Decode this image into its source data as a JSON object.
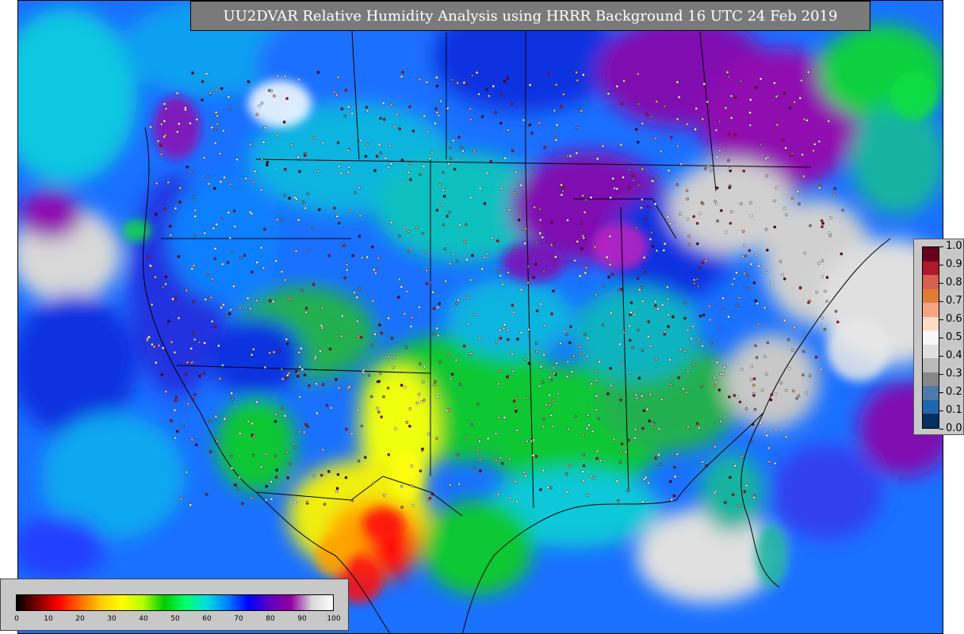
{
  "title": "UU2DVAR Relative Humidity Analysis using HRRR Background 16 UTC 24 Feb 2019",
  "rh_colorbar": {
    "ticks": [
      "0",
      "10",
      "20",
      "30",
      "40",
      "50",
      "60",
      "70",
      "80",
      "90",
      "100"
    ],
    "range": [
      0,
      100
    ],
    "colors": [
      "#000000",
      "#7f0000",
      "#ff0000",
      "#ff6a00",
      "#ffcc00",
      "#ffff00",
      "#b4ff00",
      "#00cc00",
      "#00ff66",
      "#00e0e0",
      "#0080ff",
      "#0000ff",
      "#6000c0",
      "#9000a0",
      "#d8d8d8",
      "#ffffff"
    ]
  },
  "obs_colorbar": {
    "ticks": [
      "1.0",
      "0.9",
      "0.8",
      "0.7",
      "0.6",
      "0.5",
      "0.4",
      "0.3",
      "0.2",
      "0.1",
      "0.0"
    ],
    "range": [
      0.0,
      1.0
    ],
    "colors": [
      "#67001f",
      "#b2182b",
      "#d6604d",
      "#e07b39",
      "#f4a582",
      "#fddbc7",
      "#f7f7f7",
      "#e0e0e0",
      "#bababa",
      "#878787",
      "#4d7aa8",
      "#2166ac",
      "#053061"
    ]
  },
  "map_colors": {
    "ocean_blue": "#1a6cff",
    "deep_blue": "#1020d0",
    "cyan": "#10c8d8",
    "teal": "#18b4a0",
    "green": "#10c830",
    "yellow": "#f0ff10",
    "orange": "#ffa000",
    "red": "#ff1010",
    "purple": "#8010b0",
    "magenta": "#c020c0",
    "grey": "#cfcfcf",
    "white": "#f2f2f2"
  }
}
